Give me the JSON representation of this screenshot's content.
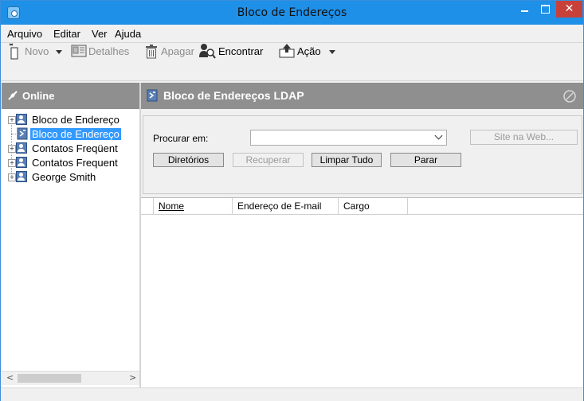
{
  "window": {
    "title": "Bloco de Endereços"
  },
  "menu": [
    "Arquivo",
    "Editar",
    "Ver",
    "Ajuda"
  ],
  "toolbar": {
    "novo": "Novo",
    "detalhes": "Detalhes",
    "apagar": "Apagar",
    "encontrar": "Encontrar",
    "acao": "Ação"
  },
  "left_pane": {
    "header": "Online",
    "items": [
      {
        "label": "Bloco de Endereço",
        "selected": false,
        "icon": "user-book-icon"
      },
      {
        "label": "Bloco de Endereço",
        "selected": true,
        "icon": "ldap-book-icon"
      },
      {
        "label": "Contatos Freqüent",
        "selected": false,
        "icon": "user-book-icon"
      },
      {
        "label": "Contatos Frequent",
        "selected": false,
        "icon": "user-book-icon"
      },
      {
        "label": "George Smith",
        "selected": false,
        "icon": "user-book-icon"
      }
    ]
  },
  "right_pane": {
    "header": "Bloco de Endereços LDAP",
    "search": {
      "label": "Procurar em:",
      "combo_value": "",
      "site_button": "Site na Web...",
      "buttons": {
        "diretorios": "Diretórios",
        "recuperar": "Recuperar",
        "limpar": "Limpar Tudo",
        "parar": "Parar"
      }
    },
    "columns": [
      "Nome",
      "Endereço de E-mail",
      "Cargo"
    ]
  },
  "colors": {
    "titlebar": "#1e90e8",
    "close_button": "#c7413a",
    "pane_header": "#8f8f8f",
    "selection": "#3399ff"
  }
}
